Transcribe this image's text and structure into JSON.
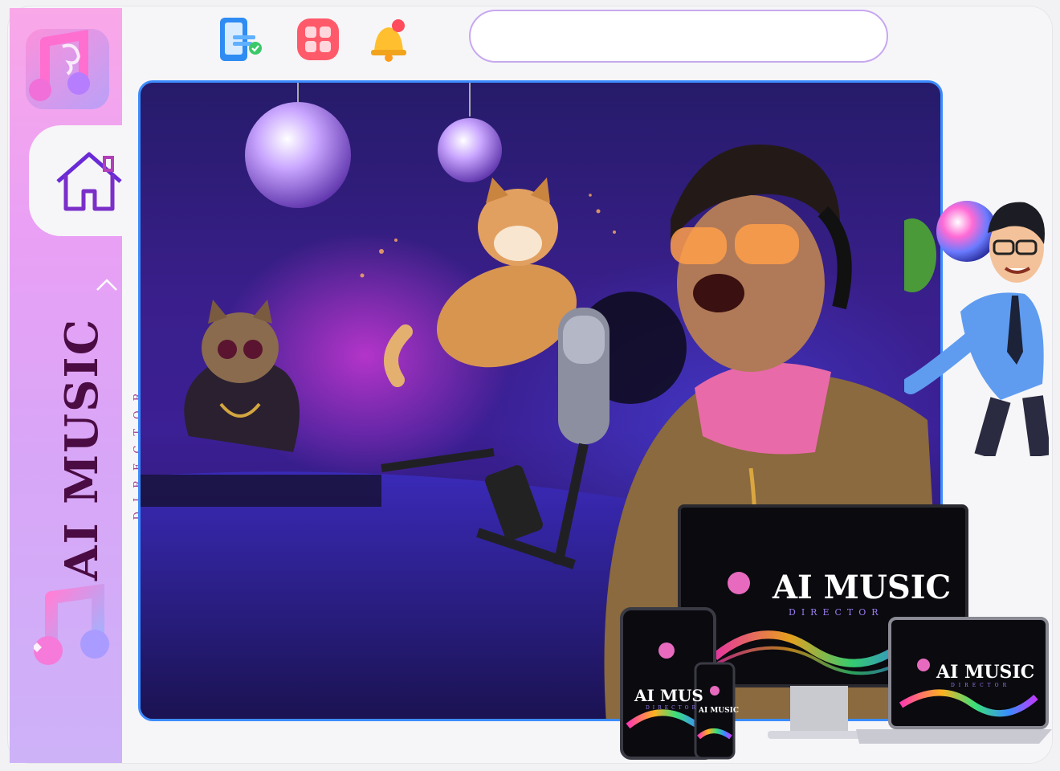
{
  "sidebar": {
    "brand_title": "AI MUSIC",
    "brand_subtitle": "DIRECTOR",
    "nav": {
      "home_icon": "home-icon",
      "collapse_icon": "chevron-up-icon"
    }
  },
  "toolbar": {
    "icons": [
      "document-check-icon",
      "grid-apps-icon",
      "notification-bell-icon"
    ],
    "search_value": ""
  },
  "hero": {
    "image": "singer-with-cat-and-dog-in-studio"
  },
  "devices": {
    "monitor_title": "AI MUSIC",
    "monitor_subtitle": "DIRECTOR",
    "tablet_title": "AI MUS",
    "tablet_subtitle": "DIRECTOR",
    "phone_title": "AI MUSIC",
    "laptop_title": "AI MUSIC",
    "laptop_subtitle": "DIRECTOR"
  },
  "colors": {
    "accent": "#3c8cff",
    "sidebar_top": "#f9a8e8",
    "sidebar_bottom": "#cdb2f8",
    "brand_text": "#4a0c42",
    "search_border": "#c8a8f0"
  }
}
